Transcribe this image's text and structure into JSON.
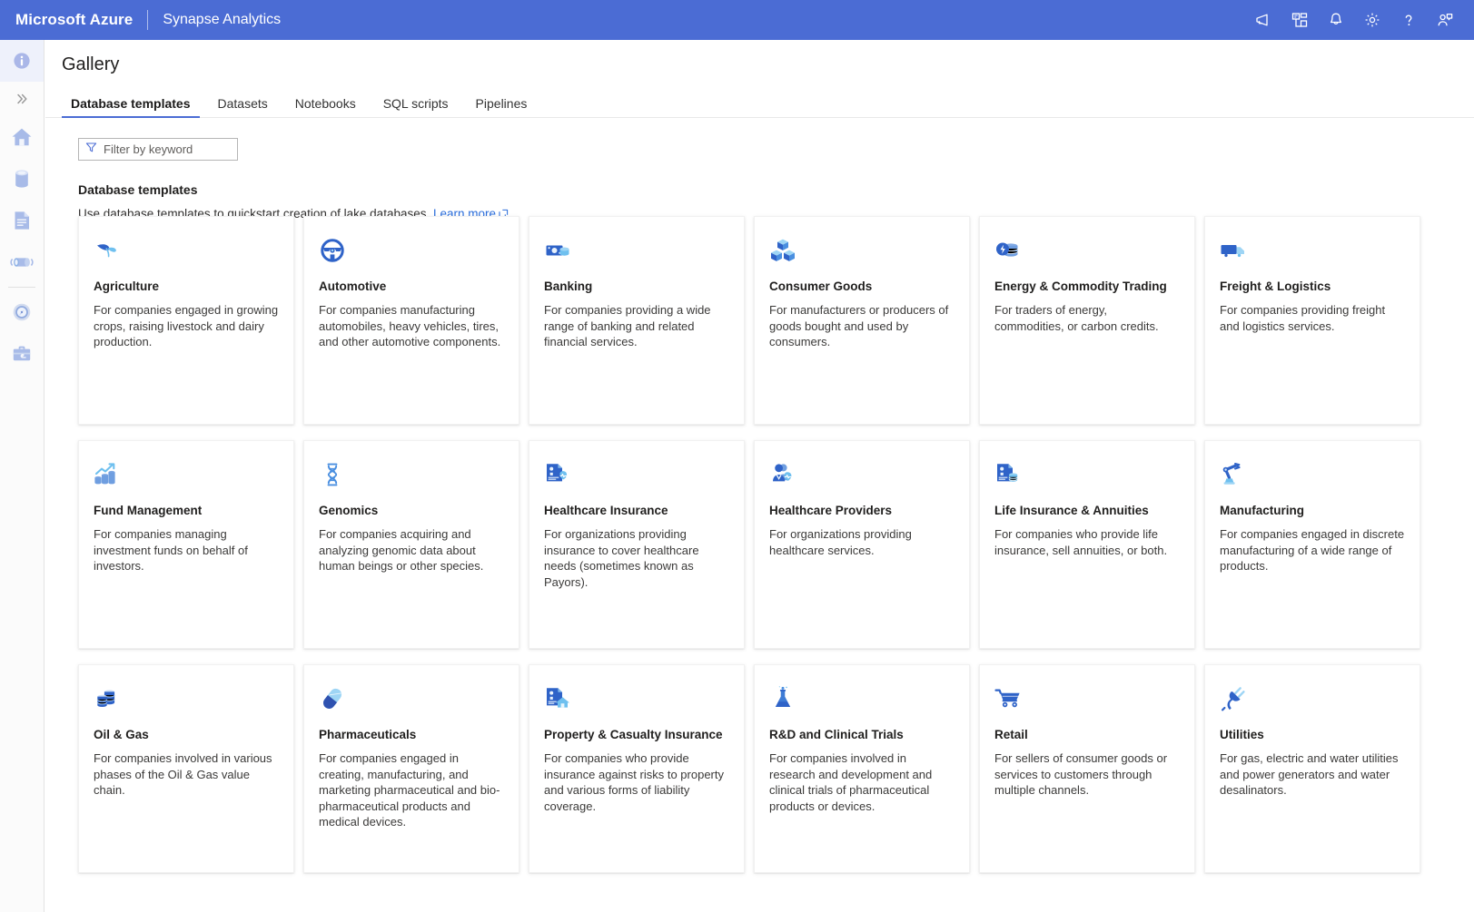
{
  "topbar": {
    "brand": "Microsoft Azure",
    "product": "Synapse Analytics",
    "actions": [
      {
        "name": "feedback-icon",
        "label": "Feedback"
      },
      {
        "name": "cloud-shell-icon",
        "label": "Cloud Shell"
      },
      {
        "name": "notifications-bell-icon",
        "label": "Notifications"
      },
      {
        "name": "gear-icon",
        "label": "Settings"
      },
      {
        "name": "help-question-icon",
        "label": "Help"
      },
      {
        "name": "account-person-icon",
        "label": "Account"
      }
    ]
  },
  "rail": {
    "items": [
      {
        "name": "info-icon",
        "label": "Info"
      },
      {
        "name": "chevron-double-right-icon",
        "label": "Expand"
      },
      {
        "name": "home-icon",
        "label": "Home"
      },
      {
        "name": "data-cylinder-icon",
        "label": "Data"
      },
      {
        "name": "develop-document-icon",
        "label": "Develop"
      },
      {
        "name": "integrate-pipeline-icon",
        "label": "Integrate"
      },
      {
        "name": "monitor-gauge-icon",
        "label": "Monitor"
      },
      {
        "name": "manage-toolbox-icon",
        "label": "Manage"
      }
    ]
  },
  "page": {
    "title": "Gallery"
  },
  "tabs": [
    {
      "label": "Database templates",
      "selected": true
    },
    {
      "label": "Datasets",
      "selected": false
    },
    {
      "label": "Notebooks",
      "selected": false
    },
    {
      "label": "SQL scripts",
      "selected": false
    },
    {
      "label": "Pipelines",
      "selected": false
    }
  ],
  "filter": {
    "placeholder": "Filter by keyword",
    "value": ""
  },
  "section": {
    "title": "Database templates",
    "description": "Use database templates to quickstart creation of lake databases.",
    "link_text": "Learn more"
  },
  "cards": [
    {
      "icon": "leaf-icon",
      "title": "Agriculture",
      "desc": "For companies engaged in growing crops, raising livestock and dairy production."
    },
    {
      "icon": "steering-wheel-icon",
      "title": "Automotive",
      "desc": "For companies manufacturing automobiles, heavy vehicles, tires, and other automotive components."
    },
    {
      "icon": "money-coins-icon",
      "title": "Banking",
      "desc": "For companies providing a wide range of banking and related financial services."
    },
    {
      "icon": "boxes-icon",
      "title": "Consumer Goods",
      "desc": "For manufacturers or producers of goods bought and used by consumers."
    },
    {
      "icon": "energy-coins-icon",
      "title": "Energy & Commodity Trading",
      "desc": "For traders of energy, commodities, or carbon credits."
    },
    {
      "icon": "truck-icon",
      "title": "Freight & Logistics",
      "desc": "For companies providing freight and logistics services."
    },
    {
      "icon": "chart-coins-icon",
      "title": "Fund Management",
      "desc": "For companies managing investment funds on behalf of investors."
    },
    {
      "icon": "dna-icon",
      "title": "Genomics",
      "desc": "For companies acquiring and analyzing genomic data about human beings or other species."
    },
    {
      "icon": "health-card-icon",
      "title": "Healthcare Insurance",
      "desc": "For organizations providing insurance to cover healthcare needs (sometimes known as Payors)."
    },
    {
      "icon": "doctor-person-icon",
      "title": "Healthcare Providers",
      "desc": "For organizations providing healthcare services."
    },
    {
      "icon": "policy-coins-icon",
      "title": "Life Insurance & Annuities",
      "desc": "For companies who provide life insurance, sell annuities, or both."
    },
    {
      "icon": "robot-arm-icon",
      "title": "Manufacturing",
      "desc": "For companies engaged in discrete manufacturing of a wide range of products."
    },
    {
      "icon": "oil-barrels-icon",
      "title": "Oil & Gas",
      "desc": "For companies involved in various phases of the Oil & Gas value chain."
    },
    {
      "icon": "pill-capsule-icon",
      "title": "Pharmaceuticals",
      "desc": "For companies engaged in creating, manufacturing, and marketing pharmaceutical and bio-pharmaceutical products and medical devices."
    },
    {
      "icon": "policy-house-icon",
      "title": "Property & Casualty Insurance",
      "desc": "For companies who provide insurance against risks to property and various forms of liability coverage."
    },
    {
      "icon": "flask-icon",
      "title": "R&D and Clinical Trials",
      "desc": "For companies involved in research and development and clinical trials of pharmaceutical products or devices."
    },
    {
      "icon": "shopping-cart-icon",
      "title": "Retail",
      "desc": "For sellers of consumer goods or services to customers through multiple channels."
    },
    {
      "icon": "power-plug-icon",
      "title": "Utilities",
      "desc": "For gas, electric and water utilities and power generators and water desalinators."
    }
  ],
  "colors": {
    "azure_blue": "#4b6cd4",
    "accent_link": "#2a6ddb",
    "icon_dark_blue": "#2c5fc9",
    "icon_light_blue": "#7fc4ef"
  }
}
